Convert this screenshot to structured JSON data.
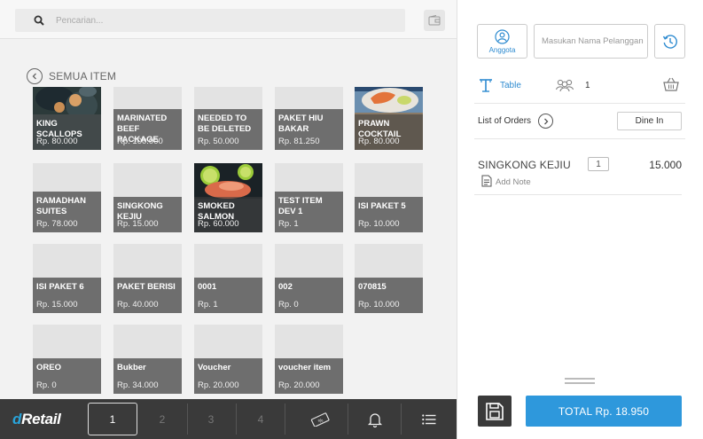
{
  "search": {
    "placeholder": "Pencarian..."
  },
  "catalog": {
    "back_label": "SEMUA ITEM",
    "items": [
      {
        "name": "KING SCALLOPS",
        "price": "Rp. 80.000",
        "image": "scallops-photo"
      },
      {
        "name": "MARINATED BEEF PACKAGE",
        "price": "Rp. 100.000"
      },
      {
        "name": "NEEDED TO BE DELETED",
        "price": "Rp. 50.000"
      },
      {
        "name": "PAKET HIU BAKAR",
        "price": "Rp. 81.250"
      },
      {
        "name": "PRAWN COCKTAIL",
        "price": "Rp. 80.000",
        "image": "prawn-photo"
      },
      {
        "name": "RAMADHAN SUITES",
        "price": "Rp. 78.000"
      },
      {
        "name": "SINGKONG KEJIU",
        "price": "Rp. 15.000"
      },
      {
        "name": "SMOKED SALMON",
        "price": "Rp. 60.000",
        "image": "salmon-photo"
      },
      {
        "name": "TEST ITEM DEV 1",
        "price": "Rp. 1"
      },
      {
        "name": "ISI PAKET 5",
        "price": "Rp. 10.000"
      },
      {
        "name": "ISI PAKET 6",
        "price": "Rp. 15.000"
      },
      {
        "name": "PAKET BERISI",
        "price": "Rp. 40.000"
      },
      {
        "name": "0001",
        "price": "Rp. 1"
      },
      {
        "name": "002",
        "price": "Rp. 0"
      },
      {
        "name": "070815",
        "price": "Rp. 10.000"
      },
      {
        "name": "OREO",
        "price": "Rp. 0"
      },
      {
        "name": "Bukber",
        "price": "Rp. 34.000"
      },
      {
        "name": "Voucher",
        "price": "Rp. 20.000"
      },
      {
        "name": "voucher item",
        "price": "Rp. 20.000"
      }
    ]
  },
  "bottom_bar": {
    "logo_d": "d",
    "logo_r": "Retail",
    "pages": [
      "1",
      "2",
      "3",
      "4"
    ],
    "active_page": "1",
    "icons": [
      "voucher-icon",
      "bell-icon",
      "menu-icon"
    ]
  },
  "customer": {
    "member_label": "Anggota",
    "name_placeholder": "Masukan Nama Pelanggan"
  },
  "table": {
    "label": "Table",
    "guest_count": "1"
  },
  "orders": {
    "label": "List of Orders",
    "type": "Dine In",
    "items": [
      {
        "name": "SINGKONG KEJIU",
        "qty": "1",
        "price": "15.000",
        "note_label": "Add Note"
      }
    ]
  },
  "total": {
    "label": "TOTAL Rp. 18.950"
  },
  "colors": {
    "accent": "#2e98dc",
    "dark_bar": "#3a3a3a",
    "caption": "#646464"
  }
}
